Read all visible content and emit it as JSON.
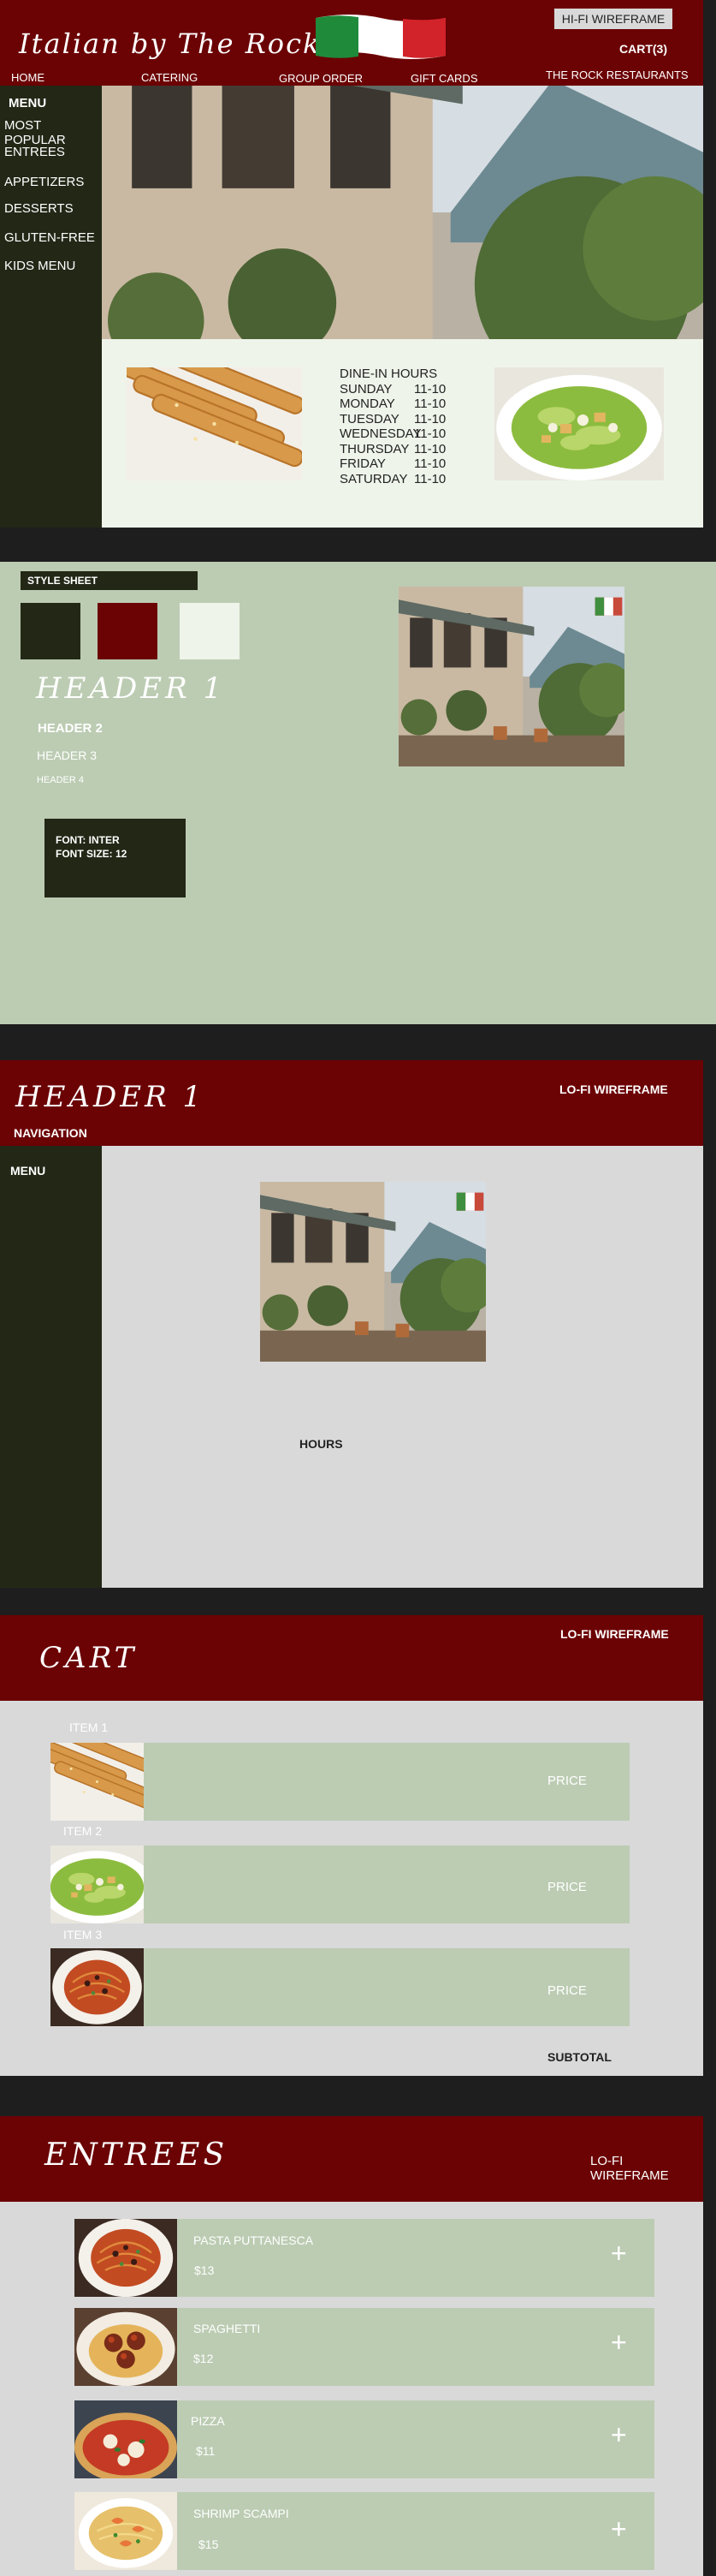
{
  "hifi": {
    "brand": "Italian by The Rock",
    "badge": "HI-FI WIREFRAME",
    "cart": "CART(3)",
    "nav": [
      "HOME",
      "CATERING",
      "GROUP ORDER",
      "GIFT CARDS",
      "THE ROCK RESTAURANTS"
    ],
    "menu_items": [
      "MENU",
      "MOST POPULAR",
      "ENTREES",
      "APPETIZERS",
      "DESSERTS",
      "GLUTEN-FREE",
      "KIDS MENU"
    ],
    "hours": [
      {
        "day": "DINE-IN HOURS",
        "time": ""
      },
      {
        "day": "SUNDAY",
        "time": "11-10"
      },
      {
        "day": "MONDAY",
        "time": "11-10"
      },
      {
        "day": "TUESDAY",
        "time": "11-10"
      },
      {
        "day": "WEDNESDAY",
        "time": "11-10"
      },
      {
        "day": "THURSDAY",
        "time": "11-10"
      },
      {
        "day": "FRIDAY",
        "time": "11-10"
      },
      {
        "day": "SATURDAY",
        "time": "11-10"
      }
    ]
  },
  "style_sheet": {
    "title": "STYLE SHEET",
    "swatches": [
      "#232716",
      "#6b0204",
      "#eef4ea"
    ],
    "h1": "HEADER 1",
    "h2": "HEADER 2",
    "h3": "HEADER 3",
    "h4": "HEADER 4",
    "font_line1": "FONT: INTER",
    "font_line2": "FONT SIZE: 12"
  },
  "lofi_home": {
    "header": "HEADER 1",
    "badge": "LO-FI WIREFRAME",
    "navigation": "NAVIGATION",
    "menu": "MENU",
    "hours": "HOURS"
  },
  "cart": {
    "title": "CART",
    "badge": "LO-FI WIREFRAME",
    "items": [
      {
        "label": "ITEM 1",
        "price": "PRICE"
      },
      {
        "label": "ITEM 2",
        "price": "PRICE"
      },
      {
        "label": "ITEM 3",
        "price": "PRICE"
      }
    ],
    "subtotal": "SUBTOTAL"
  },
  "entrees": {
    "title": "ENTREES",
    "badge": "LO-FI WIREFRAME",
    "items": [
      {
        "name": "PASTA PUTTANESCA",
        "price": "$13",
        "add": "+"
      },
      {
        "name": "SPAGHETTI",
        "price": "$12",
        "add": "+"
      },
      {
        "name": "PIZZA",
        "price": "$11",
        "add": "+"
      },
      {
        "name": "SHRIMP SCAMPI",
        "price": "$15",
        "add": "+"
      }
    ]
  },
  "colors": {
    "maroon": "#6b0204",
    "olive": "#232716",
    "sage": "#bcccb3",
    "cream": "#eef4ea",
    "gray": "#d9d9d9"
  }
}
